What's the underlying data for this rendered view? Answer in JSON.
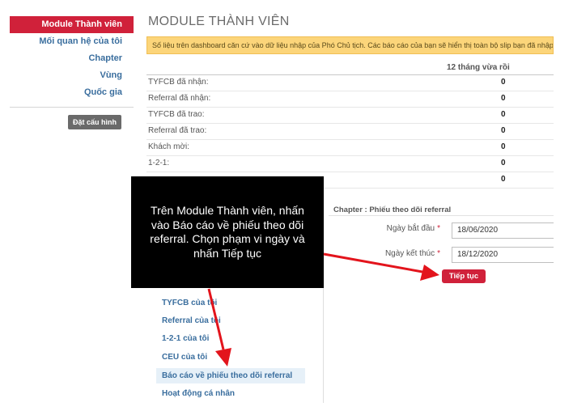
{
  "sidebar": {
    "active_item": "Module Thành viên",
    "items": [
      {
        "label": "Mối quan hệ của tôi"
      },
      {
        "label": "Chapter"
      },
      {
        "label": "Vùng"
      },
      {
        "label": "Quốc gia"
      }
    ],
    "config_button": "Đặt cấu hình"
  },
  "main": {
    "title": "MODULE THÀNH VIÊN",
    "notice": "Số liệu trên dashboard căn cứ vào dữ liệu nhập của Phó Chủ tịch. Các báo cáo của bạn sẽ hiển thị toàn bộ slip bạn đã nhập tr",
    "period_header": "12 tháng vừa rồi",
    "stats": [
      {
        "label": "TYFCB đã nhận:",
        "value": "0"
      },
      {
        "label": "Referral đã nhận:",
        "value": "0"
      },
      {
        "label": "TYFCB đã trao:",
        "value": "0"
      },
      {
        "label": "Referral đã trao:",
        "value": "0"
      },
      {
        "label": "Khách mời:",
        "value": "0"
      },
      {
        "label": "1-2-1:",
        "value": "0"
      },
      {
        "label": "",
        "value": "0"
      }
    ]
  },
  "report_form": {
    "title": "Chapter : Phiếu theo dõi referral",
    "start_label": "Ngày bắt đầu",
    "start_value": "18/06/2020",
    "end_label": "Ngày kết thúc",
    "end_value": "18/12/2020",
    "required_mark": "*",
    "submit_label": "Tiếp tục"
  },
  "report_menu": {
    "items": [
      {
        "label": "TYFCB của tôi"
      },
      {
        "label": "Referral của tôi"
      },
      {
        "label": "1-2-1 của tôi"
      },
      {
        "label": "CEU của tôi"
      },
      {
        "label": "Báo cáo về phiếu theo dõi referral"
      },
      {
        "label": "Hoạt động cá nhân"
      }
    ]
  },
  "callout": {
    "text": "Trên Module Thành viên, nhấn vào Báo cáo về phiếu theo dõi referral. Chọn phạm vi ngày và nhấn Tiếp tục"
  },
  "colors": {
    "brand_red": "#d0213a",
    "link_blue": "#3a6e9e",
    "notice_yellow": "#fcd57a",
    "arrow_red": "#e3141c"
  }
}
